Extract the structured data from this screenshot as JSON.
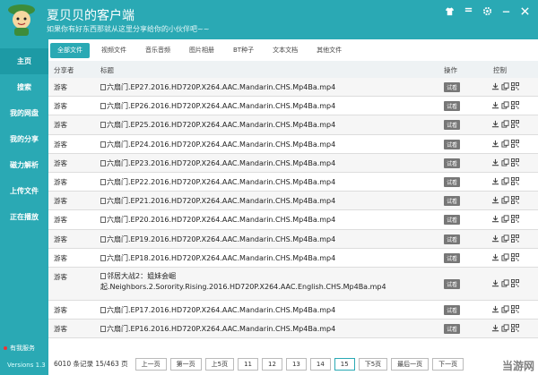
{
  "header": {
    "title": "夏贝贝的客户端",
    "subtitle": "如果你有好东西那就从这里分享给你的小伙伴吧~~",
    "controls": [
      "shirt-icon",
      "minimize-bar-icon",
      "gear-icon",
      "minimize-icon",
      "close-icon"
    ]
  },
  "sidebar": {
    "items": [
      {
        "label": "主页",
        "active": true
      },
      {
        "label": "搜索"
      },
      {
        "label": "我的网盘"
      },
      {
        "label": "我的分享"
      },
      {
        "label": "磁力解析"
      },
      {
        "label": "上传文件"
      },
      {
        "label": "正在播放"
      }
    ],
    "vip_label": "有我服务",
    "version": "Versions 1.3"
  },
  "tabs": [
    "全部文件",
    "视频文件",
    "音乐音频",
    "图片相册",
    "BT种子",
    "文本文档",
    "其他文件"
  ],
  "columns": {
    "sharer": "分享者",
    "title": "标题",
    "action": "操作",
    "control": "控制"
  },
  "try_label": "试看",
  "rows": [
    {
      "sharer": "游客",
      "title": "六扇门.EP27.2016.HD720P.X264.AAC.Mandarin.CHS.Mp4Ba.mp4"
    },
    {
      "sharer": "游客",
      "title": "六扇门.EP26.2016.HD720P.X264.AAC.Mandarin.CHS.Mp4Ba.mp4"
    },
    {
      "sharer": "游客",
      "title": "六扇门.EP25.2016.HD720P.X264.AAC.Mandarin.CHS.Mp4Ba.mp4"
    },
    {
      "sharer": "游客",
      "title": "六扇门.EP24.2016.HD720P.X264.AAC.Mandarin.CHS.Mp4Ba.mp4"
    },
    {
      "sharer": "游客",
      "title": "六扇门.EP23.2016.HD720P.X264.AAC.Mandarin.CHS.Mp4Ba.mp4"
    },
    {
      "sharer": "游客",
      "title": "六扇门.EP22.2016.HD720P.X264.AAC.Mandarin.CHS.Mp4Ba.mp4"
    },
    {
      "sharer": "游客",
      "title": "六扇门.EP21.2016.HD720P.X264.AAC.Mandarin.CHS.Mp4Ba.mp4"
    },
    {
      "sharer": "游客",
      "title": "六扇门.EP20.2016.HD720P.X264.AAC.Mandarin.CHS.Mp4Ba.mp4"
    },
    {
      "sharer": "游客",
      "title": "六扇门.EP19.2016.HD720P.X264.AAC.Mandarin.CHS.Mp4Ba.mp4"
    },
    {
      "sharer": "游客",
      "title": "六扇门.EP18.2016.HD720P.X264.AAC.Mandarin.CHS.Mp4Ba.mp4"
    },
    {
      "sharer": "游客",
      "title": "邻居大战2：姐妹会崛起.Neighbors.2.Sorority.Rising.2016.HD720P.X264.AAC.English.CHS.Mp4Ba.mp4"
    },
    {
      "sharer": "游客",
      "title": "六扇门.EP17.2016.HD720P.X264.AAC.Mandarin.CHS.Mp4Ba.mp4"
    },
    {
      "sharer": "游客",
      "title": "六扇门.EP16.2016.HD720P.X264.AAC.Mandarin.CHS.Mp4Ba.mp4"
    }
  ],
  "pager": {
    "count": "6010 条记录 15/463 页",
    "prev": "上一页",
    "first": "第一页",
    "prev5": "上5页",
    "pages": [
      "11",
      "12",
      "13",
      "14",
      "15"
    ],
    "current": "15",
    "next5": "下5页",
    "last": "最后一页",
    "next": "下一页"
  },
  "watermark": "当游网",
  "colors": {
    "accent": "#2aa9b4"
  }
}
